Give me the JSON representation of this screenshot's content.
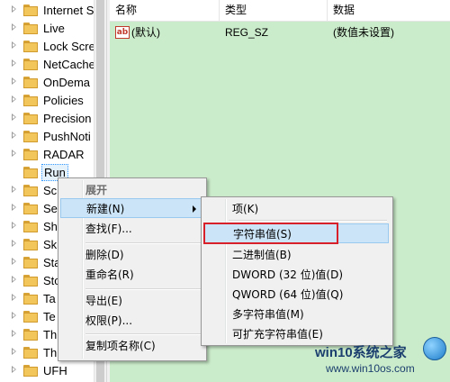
{
  "tree": {
    "items": [
      {
        "label": "Internet S",
        "selected": false
      },
      {
        "label": "Live",
        "selected": false
      },
      {
        "label": "Lock Scre",
        "selected": false
      },
      {
        "label": "NetCache",
        "selected": false
      },
      {
        "label": "OnDema",
        "selected": false
      },
      {
        "label": "Policies",
        "selected": false
      },
      {
        "label": "Precision",
        "selected": false
      },
      {
        "label": "PushNoti",
        "selected": false
      },
      {
        "label": "RADAR",
        "selected": false
      },
      {
        "label": "Run",
        "selected": true
      },
      {
        "label": "Sc",
        "selected": false
      },
      {
        "label": "Se",
        "selected": false
      },
      {
        "label": "Sh",
        "selected": false
      },
      {
        "label": "Sk",
        "selected": false
      },
      {
        "label": "Sta",
        "selected": false
      },
      {
        "label": "Sto",
        "selected": false
      },
      {
        "label": "Ta",
        "selected": false
      },
      {
        "label": "Te",
        "selected": false
      },
      {
        "label": "Th",
        "selected": false
      },
      {
        "label": "Th",
        "selected": false
      },
      {
        "label": "UFH",
        "selected": false
      }
    ]
  },
  "values_pane": {
    "columns": {
      "name": "名称",
      "type": "类型",
      "data": "数据"
    },
    "rows": [
      {
        "icon": "string-value-icon",
        "icon_text": "ab",
        "name": "(默认)",
        "type": "REG_SZ",
        "data": "(数值未设置)"
      }
    ],
    "background_color": "#cbeccb"
  },
  "context_menu": {
    "items": [
      {
        "label": "展开",
        "disabled": true
      },
      {
        "label": "新建(N)",
        "has_submenu": true,
        "hover": true
      },
      {
        "label": "查找(F)...",
        "disabled": false
      },
      {
        "label": "删除(D)",
        "disabled": false
      },
      {
        "label": "重命名(R)",
        "disabled": false
      },
      {
        "label": "导出(E)",
        "disabled": false
      },
      {
        "label": "权限(P)...",
        "disabled": false
      },
      {
        "label": "复制项名称(C)",
        "disabled": false
      }
    ]
  },
  "submenu": {
    "items": [
      {
        "label": "项(K)"
      },
      {
        "label": "字符串值(S)",
        "hover": true,
        "highlighted": true
      },
      {
        "label": "二进制值(B)"
      },
      {
        "label": "DWORD (32 位)值(D)"
      },
      {
        "label": "QWORD (64 位)值(Q)"
      },
      {
        "label": "多字符串值(M)"
      },
      {
        "label": "可扩充字符串值(E)"
      }
    ],
    "highlight_color": "#d8202a"
  },
  "watermark": {
    "title": "win10系统之家",
    "url": "www.win10os.com"
  }
}
